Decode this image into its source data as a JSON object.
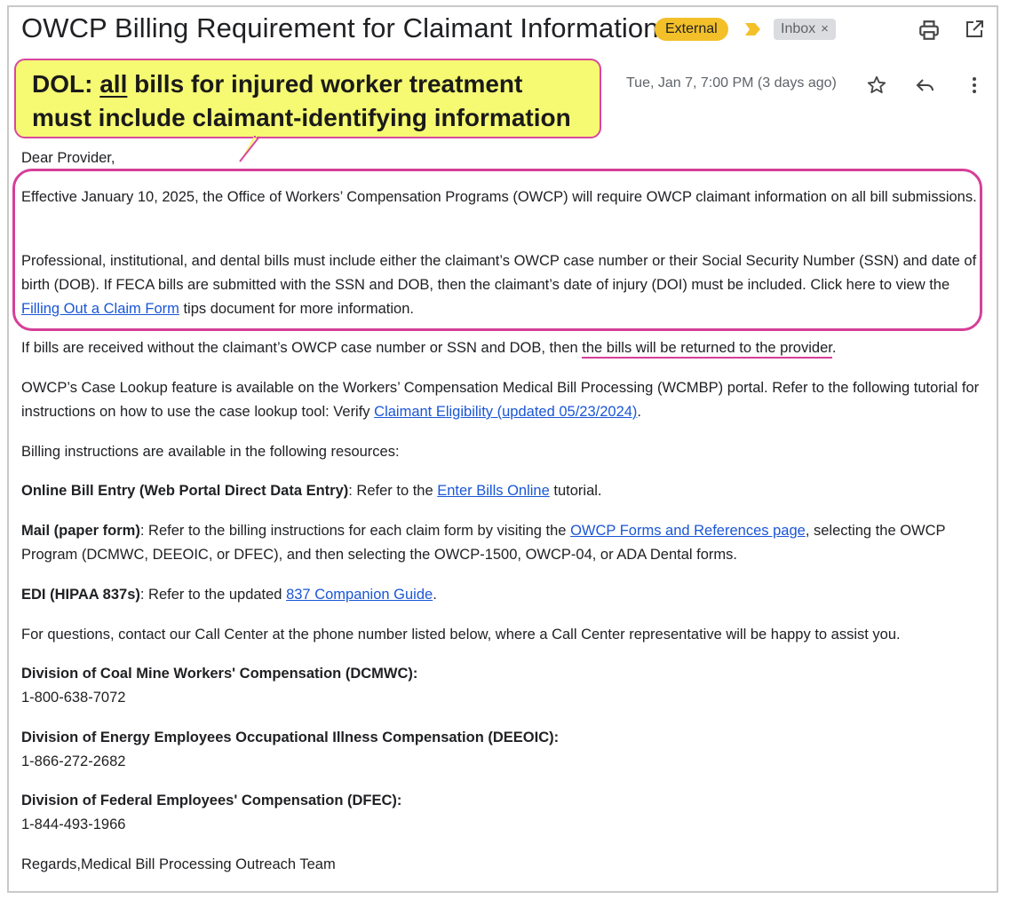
{
  "header": {
    "subject": "OWCP Billing Requirement for Claimant Information",
    "external_label": "External",
    "inbox_label": "Inbox",
    "inbox_close": "×",
    "date": "Tue, Jan 7, 7:00 PM (3 days ago)"
  },
  "callout": {
    "prefix": "DOL: ",
    "emphasis": "all",
    "line1_rest": " bills for injured worker treatment",
    "line2": "must include claimant-identifying information"
  },
  "email": {
    "greeting": "Dear Provider,",
    "p1": "Effective January 10, 2025, the Office of Workers’ Compensation Programs (OWCP) will require OWCP claimant information on all bill submissions.",
    "p2_a": "Professional, institutional, and dental bills must include either the claimant’s OWCP case number or their Social Security Number (SSN) and date of birth (DOB). If FECA bills are submitted with the SSN and DOB, then the claimant’s date of injury (DOI) must be included. Click here to view the ",
    "p2_link": "Filling Out a Claim Form",
    "p2_b": " tips document for more information.",
    "p3_a": "If bills are received without the claimant’s OWCP case number or SSN and DOB, then ",
    "p3_underlined": "the bills will be returned to the provider",
    "p3_b": ".",
    "p4_a": "OWCP’s Case Lookup feature is available on the Workers’ Compensation Medical Bill Processing (WCMBP) portal. Refer to the following tutorial for instructions on how to use the case lookup tool: Verify ",
    "p4_link": "Claimant Eligibility (updated 05/23/2024)",
    "p4_b": ".",
    "p5": "Billing instructions are available in the following resources:",
    "p6_bold": "Online Bill Entry (Web Portal Direct Data Entry)",
    "p6_a": ": Refer to the ",
    "p6_link": "Enter Bills Online",
    "p6_b": " tutorial.",
    "p7_bold": "Mail (paper form)",
    "p7_a": ": Refer to the billing instructions for each claim form by visiting the ",
    "p7_link": "OWCP Forms and References page",
    "p7_b": ", selecting the OWCP Program (DCMWC, DEEOIC, or DFEC), and then selecting the OWCP-1500, OWCP-04, or ADA Dental forms.",
    "p8_bold": "EDI (HIPAA 837s)",
    "p8_a": ": Refer to the updated ",
    "p8_link": "837 Companion Guide",
    "p8_b": ".",
    "p9": "For questions, contact our Call Center at the phone number listed below, where a Call Center representative will be happy to assist you.",
    "contacts": [
      {
        "name": "Division of Coal Mine Workers' Compensation (DCMWC):",
        "phone": "1-800-638-7072"
      },
      {
        "name": "Division of Energy Employees Occupational Illness Compensation (DEEOIC):",
        "phone": "1-866-272-2682"
      },
      {
        "name": "Division of Federal Employees' Compensation (DFEC):",
        "phone": "1-844-493-1966"
      }
    ],
    "signoff": "Regards,Medical Bill Processing Outreach Team"
  },
  "colors": {
    "external_badge": "#f3c02a",
    "callout_fill": "#f6fa72",
    "annotation_pink": "#d63f98",
    "link": "#1a56d6"
  },
  "icons": [
    "importance-marker-icon",
    "print-icon",
    "open-in-new-window-icon",
    "star-icon",
    "reply-icon",
    "more-vertical-icon"
  ]
}
